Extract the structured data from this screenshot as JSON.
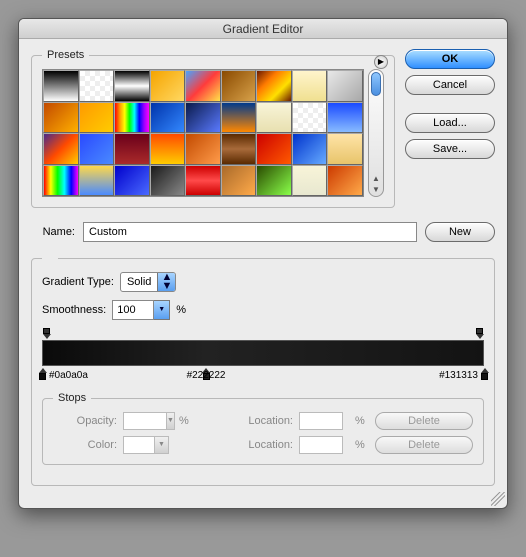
{
  "title": "Gradient Editor",
  "presets": {
    "legend": "Presets"
  },
  "buttons": {
    "ok": "OK",
    "cancel": "Cancel",
    "load": "Load...",
    "save": "Save...",
    "new": "New",
    "delete": "Delete"
  },
  "name": {
    "label": "Name:",
    "value": "Custom"
  },
  "gradientType": {
    "label": "Gradient Type:",
    "value": "Solid"
  },
  "smoothness": {
    "label": "Smoothness:",
    "value": "100",
    "unit": "%"
  },
  "colorStops": [
    {
      "hex": "#0a0a0a",
      "position": 0
    },
    {
      "hex": "#222222",
      "position": 37
    },
    {
      "hex": "#131313",
      "position": 100
    }
  ],
  "stops": {
    "legend": "Stops",
    "opacity": "Opacity:",
    "color": "Color:",
    "location": "Location:",
    "pct": "%"
  },
  "presetSwatches": [
    "linear-gradient(#000,#fff)",
    "repeating-conic-gradient(#eee 0 25%,#fff 0 50%) 0 0/10px 10px",
    "linear-gradient(#000,#fff 50%,#000)",
    "linear-gradient(135deg,#f5a400,#ffd862)",
    "linear-gradient(135deg,#4aa3ff,#ff3b3b,#ffe34a)",
    "linear-gradient(135deg,#8a4a00,#d8a24a)",
    "linear-gradient(135deg,#6a1a00,#ff7b00,#ffe000,#6a1a00)",
    "linear-gradient(#fff4cc,#f0e090)",
    "linear-gradient(135deg,#e8e8e8,#a8a8a8)",
    "linear-gradient(135deg,#c24a00,#ffb000)",
    "linear-gradient(135deg,#ff9a00,#ffcc00)",
    "linear-gradient(90deg,#ff0000,#ff9900,#ffff00,#00ff00,#00ffff,#0000ff,#9900ff,#ff00ff)",
    "linear-gradient(135deg,#0033aa,#3388ff)",
    "linear-gradient(135deg,#0a1a4a,#5a7aff)",
    "linear-gradient(#003a8c,#ff8800)",
    "linear-gradient(#f8f4d8,#e8e0b0)",
    "repeating-conic-gradient(#eee 0 25%,#fff 0 50%) 0 0/10px 10px",
    "linear-gradient(#1a4aff,#88bbff)",
    "linear-gradient(135deg,#4a2a8a,#ff4a00,#ffcc00)",
    "linear-gradient(135deg,#2a4aff,#4a8aff)",
    "linear-gradient(#6a001a,#aa2a2a)",
    "linear-gradient(#ff4a00,#ffcc00)",
    "linear-gradient(135deg,#c24a00,#ff9b4a)",
    "linear-gradient(#5a2a00,#a86a3a,#5a2a00)",
    "linear-gradient(135deg,#cc0000,#ff5a00)",
    "linear-gradient(135deg,#0033cc,#66aaff)",
    "linear-gradient(#ffe4a8,#e8c46a)",
    "linear-gradient(90deg,#ff0000,#ffff00,#00ff00,#00ffff,#0000ff,#ff00ff)",
    "linear-gradient(#ffd84a,#4a8aff)",
    "linear-gradient(135deg,#0000cc,#4a6aff)",
    "linear-gradient(135deg,#1a1a1a,#888)",
    "linear-gradient(#cc0000,#ff4a4a,#cc0000)",
    "linear-gradient(135deg,#aa6a2a,#ffaa4a)",
    "linear-gradient(135deg,#2a4a00,#8aff4a)",
    "linear-gradient(#f8f4d8,#e8e8d0)",
    "linear-gradient(135deg,#cc3a00,#ffaa4a)"
  ]
}
